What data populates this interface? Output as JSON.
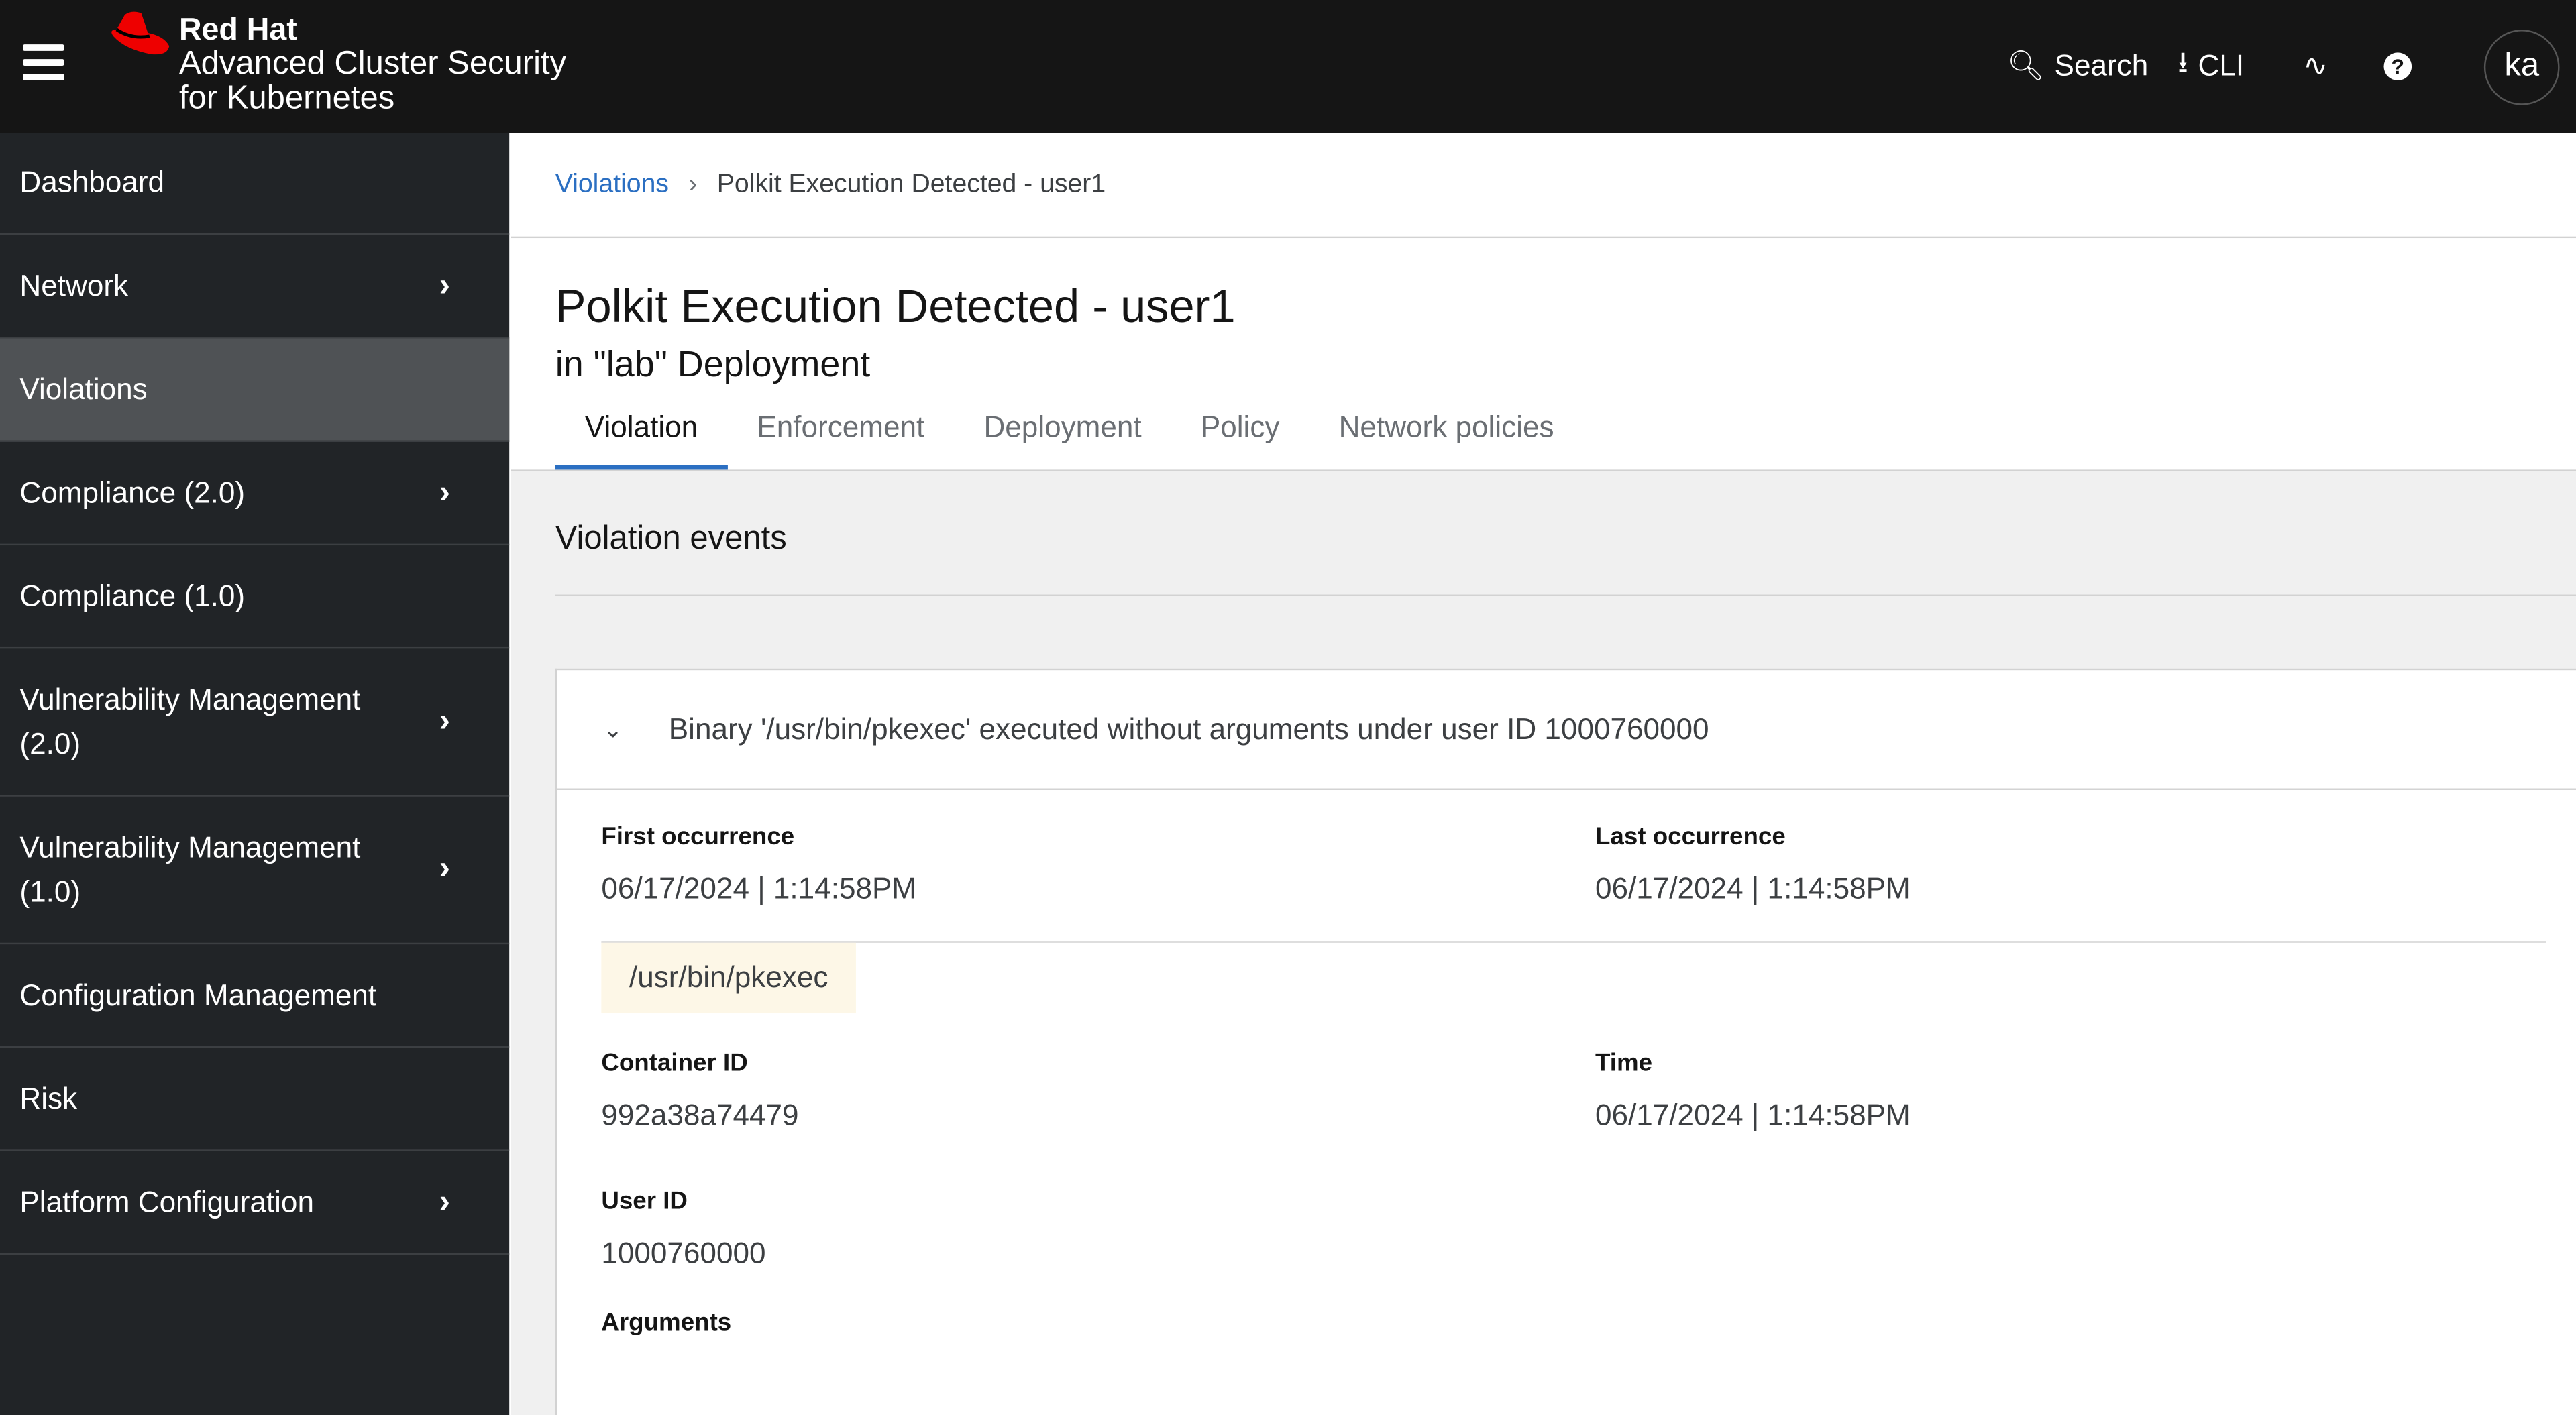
{
  "header": {
    "brand_line1": "Red Hat",
    "brand_line2": "Advanced Cluster Security",
    "brand_line3": "for Kubernetes",
    "search_label": "Search",
    "cli_label": "CLI",
    "avatar": "ka"
  },
  "sidebar": {
    "items": [
      {
        "label": "Dashboard",
        "chevron": false
      },
      {
        "label": "Network",
        "chevron": true
      },
      {
        "label": "Violations",
        "chevron": false,
        "active": true
      },
      {
        "label": "Compliance (2.0)",
        "chevron": true
      },
      {
        "label": "Compliance (1.0)",
        "chevron": false
      },
      {
        "label": "Vulnerability Management (2.0)",
        "chevron": true
      },
      {
        "label": "Vulnerability Management (1.0)",
        "chevron": true
      },
      {
        "label": "Configuration Management",
        "chevron": false
      },
      {
        "label": "Risk",
        "chevron": false
      },
      {
        "label": "Platform Configuration",
        "chevron": true
      }
    ]
  },
  "breadcrumb": {
    "parent": "Violations",
    "current": "Polkit Execution Detected - user1"
  },
  "page": {
    "title": "Polkit Execution Detected - user1",
    "subtitle": "in \"lab\" Deployment"
  },
  "tabs": [
    "Violation",
    "Enforcement",
    "Deployment",
    "Policy",
    "Network policies"
  ],
  "section_title": "Violation events",
  "event": {
    "summary": "Binary '/usr/bin/pkexec' executed without arguments under user ID 1000760000",
    "first_occurrence_label": "First occurrence",
    "first_occurrence": "06/17/2024 | 1:14:58PM",
    "last_occurrence_label": "Last occurrence",
    "last_occurrence": "06/17/2024 | 1:14:58PM",
    "process": "/usr/bin/pkexec",
    "container_id_label": "Container ID",
    "container_id": "992a38a74479",
    "time_label": "Time",
    "time": "06/17/2024 | 1:14:58PM",
    "user_id_label": "User ID",
    "user_id": "1000760000",
    "arguments_label": "Arguments"
  }
}
